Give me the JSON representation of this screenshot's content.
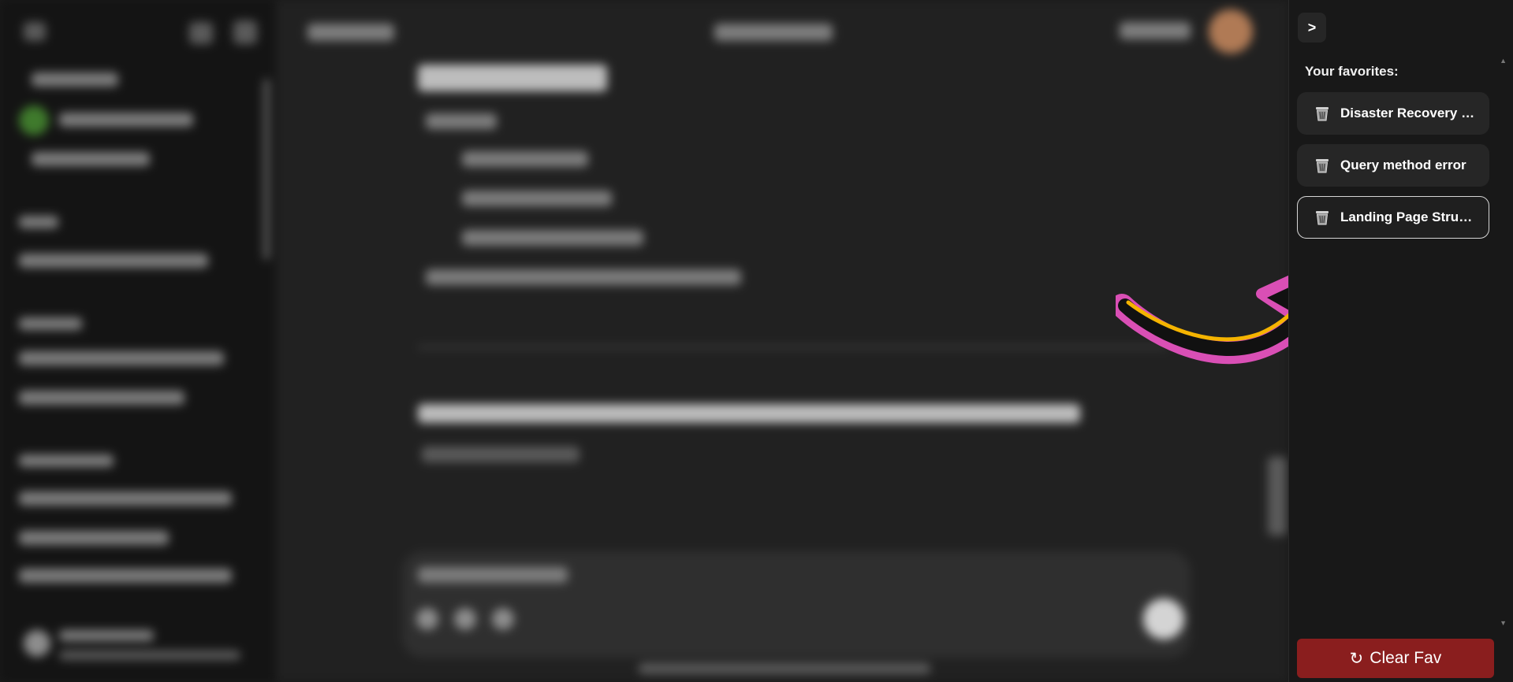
{
  "favorites_panel": {
    "toggle_label": ">",
    "title": "Your favorites:",
    "items": [
      {
        "label": "Disaster Recovery Plan",
        "icon": "trash-icon",
        "active": false
      },
      {
        "label": "Query method error",
        "icon": "trash-icon",
        "active": false
      },
      {
        "label": "Landing Page Structure",
        "icon": "trash-icon",
        "active": true
      }
    ],
    "clear_button": {
      "icon": "refresh-icon",
      "icon_glyph": "↻",
      "label": "Clear Fav"
    }
  },
  "colors": {
    "panel_bg": "#181818",
    "item_bg": "#262626",
    "clear_button_bg": "#8a1e1e",
    "arrow_outline": "#d94fb5",
    "arrow_highlight": "#f5b400",
    "arrow_fill": "#111111"
  }
}
